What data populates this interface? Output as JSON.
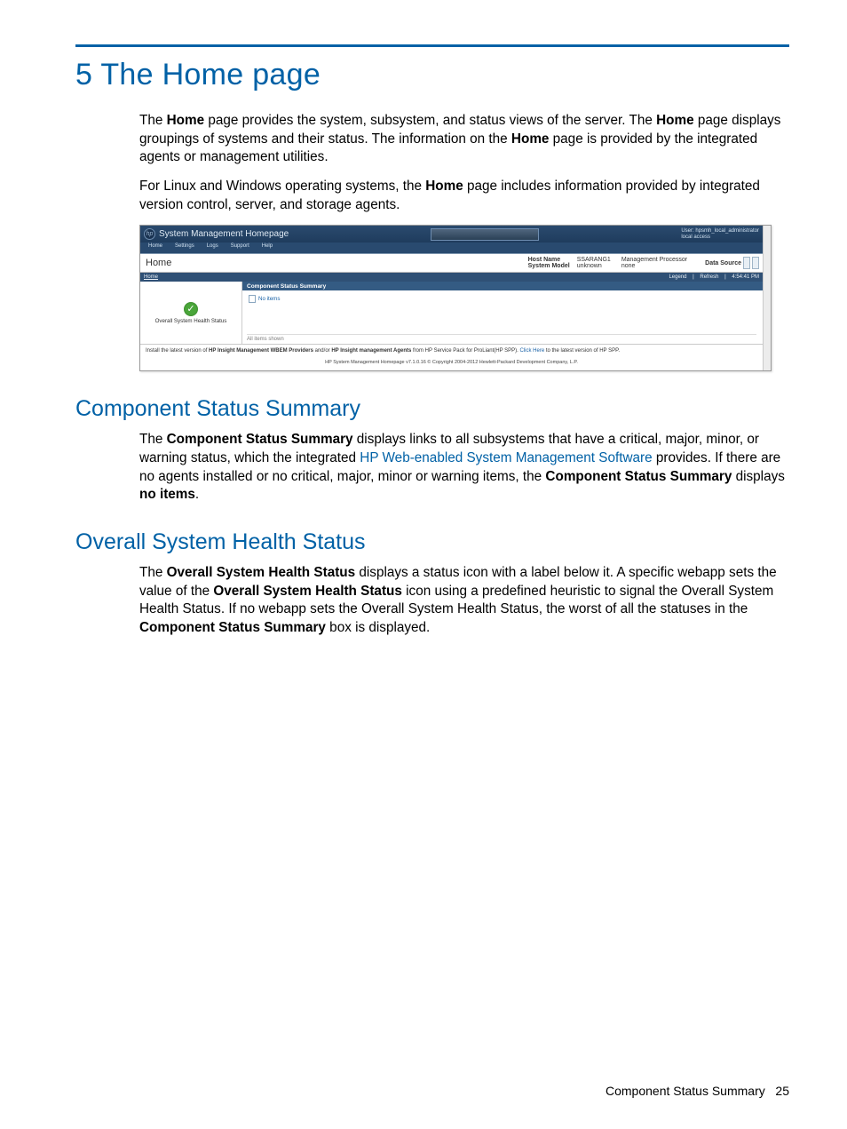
{
  "chapter_title": "5 The Home page",
  "para1_a": "The ",
  "para1_b": "Home",
  "para1_c": " page provides the system, subsystem, and status views of the server. The ",
  "para1_d": "Home",
  "para1_e": " page displays groupings of systems and their status. The information on the ",
  "para1_f": "Home",
  "para1_g": " page is provided by the integrated agents or management utilities.",
  "para2_a": "For Linux and Windows operating systems, the ",
  "para2_b": "Home",
  "para2_c": " page includes information provided by integrated version control, server, and storage agents.",
  "section1_title": "Component Status Summary",
  "sec1_a": "The ",
  "sec1_b": "Component Status Summary",
  "sec1_c": " displays links to all subsystems that have a critical, major, minor, or warning status, which the integrated ",
  "sec1_link": "HP Web-enabled System Management Software",
  "sec1_d": " provides. If there are no agents installed or no critical, major, minor or warning items, the ",
  "sec1_e": "Component Status Summary",
  "sec1_f": " displays ",
  "sec1_g": "no items",
  "sec1_h": ".",
  "section2_title": "Overall System Health Status",
  "sec2_a": "The ",
  "sec2_b": "Overall System Health Status",
  "sec2_c": " displays a status icon with a label below it. A specific webapp sets the value of the ",
  "sec2_d": "Overall System Health Status",
  "sec2_e": " icon using a predefined heuristic to signal the Overall System Health Status. If no webapp sets the Overall System Health Status, the worst of all the statuses in the ",
  "sec2_f": "Component Status Summary",
  "sec2_g": " box is displayed.",
  "footer_label": "Component Status Summary",
  "footer_page": "25",
  "smh": {
    "title": "System Management Homepage",
    "user1": "User: hpsmh_local_administrator",
    "user2": "local access",
    "tabs": [
      "Home",
      "Settings",
      "Logs",
      "Support",
      "Help"
    ],
    "home": "Home",
    "host_k": "Host Name",
    "host_v": "SSARANG1",
    "model_k": "System Model",
    "model_v": "unknown",
    "mp_k": "Management Processor",
    "mp_v": "none",
    "ds": "Data Source",
    "bc_home": "Home",
    "bc_legend": "Legend",
    "bc_refresh": "Refresh",
    "bc_time": "4:54:41 PM",
    "left_label": "Overall System Health Status",
    "boxhdr": "Component Status Summary",
    "noitems": "No items",
    "allitems": "All items shown",
    "install_a": "Install the latest version of ",
    "install_b": "HP Insight Management WBEM Providers",
    "install_c": " and/or ",
    "install_d": "HP Insight management Agents",
    "install_e": " from HP Service Pack for ProLiant(HP SPP). ",
    "install_link": "Click Here",
    "install_f": " to the latest version of HP SPP.",
    "copy": "HP System Management Homepage v7.1.0.16    © Copyright 2004-2012 Hewlett-Packard Development Company, L.P."
  }
}
